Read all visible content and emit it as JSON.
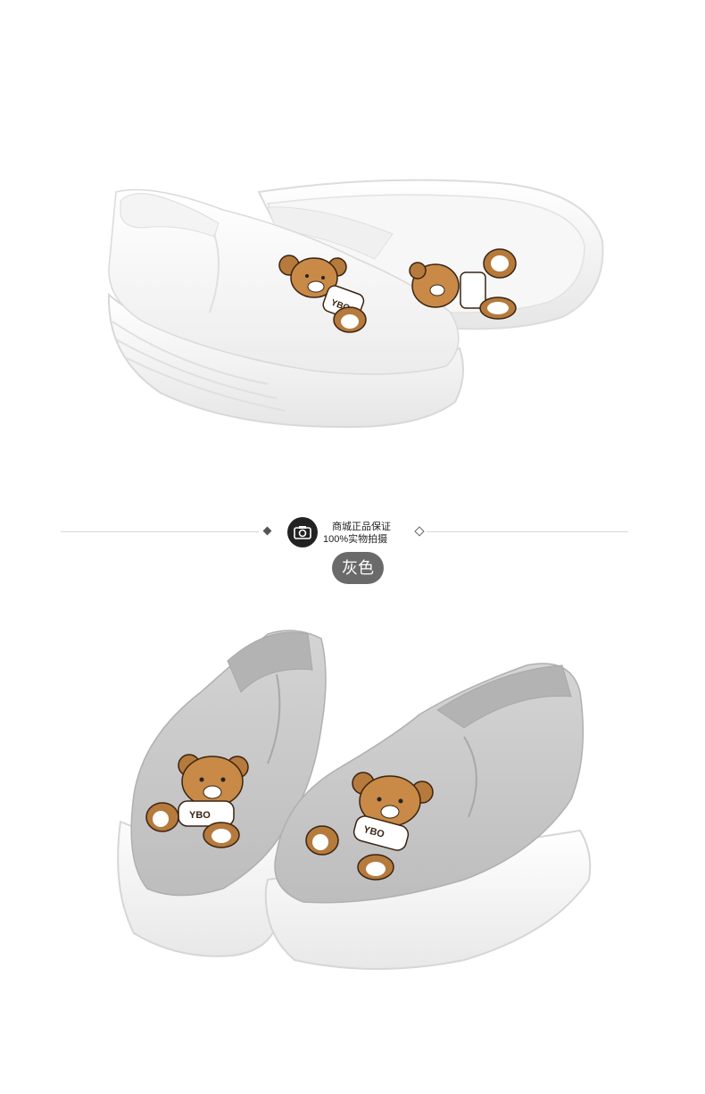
{
  "banner": {
    "guarantee_line1": "商城正品保证",
    "guarantee_line2": "100%实物拍摄",
    "color_label": "灰色"
  },
  "products": {
    "top_photo_alt": "White slip-on platform canvas shoes with embroidered teddy bear",
    "bottom_photo_alt": "Grey slip-on platform canvas shoes with embroidered teddy bear",
    "bear_shirt_text": "YBO"
  },
  "colors": {
    "shoe_white": "#fafafa",
    "shoe_grey": "#c9c9c9",
    "bear_brown": "#b57a3c",
    "pill_bg": "#6a6a6a",
    "badge_bg": "#222222"
  },
  "icons": [
    "camera-icon",
    "diamond-left-icon",
    "diamond-right-icon"
  ]
}
